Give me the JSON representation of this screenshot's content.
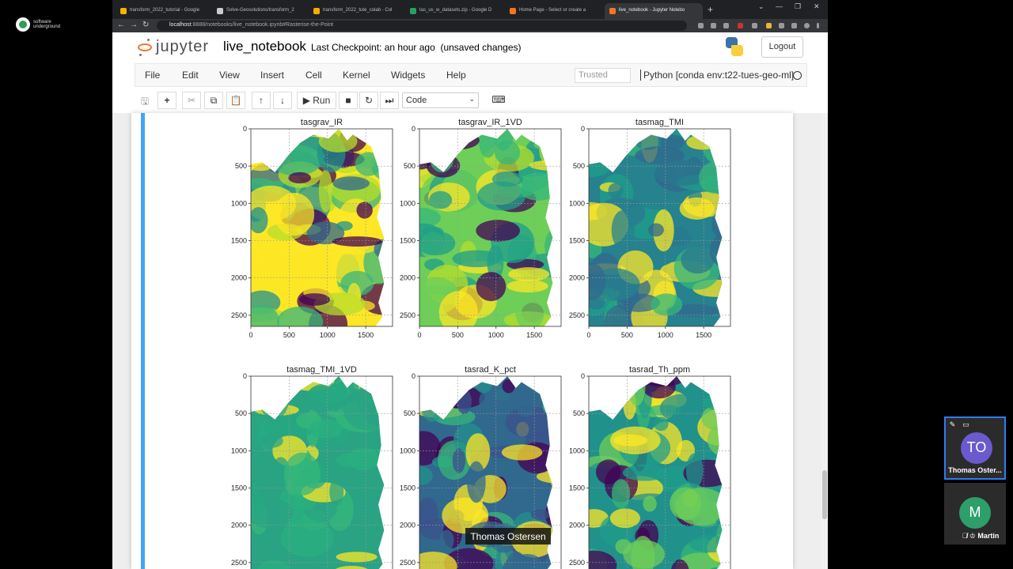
{
  "overlay_logo": {
    "text": "software underground"
  },
  "browser": {
    "tabs": [
      {
        "label": "transform_2022_tutorial - Google",
        "fav": "#f4b400"
      },
      {
        "label": "Solve-Geosolutions/transform_2",
        "fav": "#cccccc"
      },
      {
        "label": "transform_2022_tute_colab - Col",
        "fav": "#f9ab00"
      },
      {
        "label": "tas_us_w_datasets.zip - Google D",
        "fav": "#1fa463"
      },
      {
        "label": "Home Page - Select or create a",
        "fav": "#f37626"
      },
      {
        "label": "live_notebook - Jupyter Notebo",
        "fav": "#f37626"
      }
    ],
    "new_tab": "+",
    "url_host": "localhost",
    "url_path": ":8888/notebooks/live_notebook.ipynb#Rasterise-the-Point",
    "window_controls": [
      "⌄",
      "—",
      "❐",
      "✕"
    ]
  },
  "jupyter": {
    "brand": "jupyter",
    "notebook_name": "live_notebook",
    "checkpoint": "Last Checkpoint: an hour ago",
    "unsaved": "(unsaved changes)",
    "logout": "Logout",
    "menus": [
      "File",
      "Edit",
      "View",
      "Insert",
      "Cell",
      "Kernel",
      "Widgets",
      "Help"
    ],
    "trusted": "Trusted",
    "kernel": "Python [conda env:t22-tues-geo-ml]",
    "toolbar": {
      "save": "🖫",
      "add": "+",
      "cut": "✂",
      "copy": "⧉",
      "paste": "📋",
      "up": "↑",
      "down": "↓",
      "run": "▶ Run",
      "stop": "■",
      "restart": "↻",
      "ffwd": "⏭",
      "cell_type": "Code",
      "keyboard": "⌨"
    }
  },
  "figure": {
    "panels": [
      {
        "title": "tasgrav_IR",
        "palette": [
          "#fde725",
          "#b5de2b",
          "#35b779",
          "#21918c",
          "#31688e",
          "#440154"
        ]
      },
      {
        "title": "tasgrav_IR_1VD",
        "palette": [
          "#6ece58",
          "#35b779",
          "#1f9e89",
          "#b5de2b",
          "#fde725",
          "#440154"
        ]
      },
      {
        "title": "tasmag_TMI",
        "palette": [
          "#26828e",
          "#2a788e",
          "#1f9e89",
          "#35b779",
          "#31688e",
          "#fde725"
        ]
      },
      {
        "title": "tasmag_TMI_1VD",
        "palette": [
          "#2aa383",
          "#26a882",
          "#2ab07f",
          "#2aa383",
          "#35b779",
          "#fde725"
        ]
      },
      {
        "title": "tasrad_K_pct",
        "palette": [
          "#31688e",
          "#3b528b",
          "#21918c",
          "#35b779",
          "#fde725",
          "#440154"
        ]
      },
      {
        "title": "tasrad_Th_ppm",
        "palette": [
          "#21918c",
          "#1f9e89",
          "#35b779",
          "#6ece58",
          "#fde725",
          "#440154"
        ]
      }
    ],
    "yticks": [
      "0",
      "500",
      "1000",
      "1500",
      "2000",
      "2500"
    ],
    "xticks": [
      "0",
      "500",
      "1000",
      "1500"
    ]
  },
  "participants": [
    {
      "initials": "TO",
      "name": "Thomas Oster...",
      "color": "#6a5acd"
    },
    {
      "initials": "M",
      "name": "Martin",
      "color": "#2e9e6a"
    }
  ],
  "caption": "Thomas Ostersen"
}
